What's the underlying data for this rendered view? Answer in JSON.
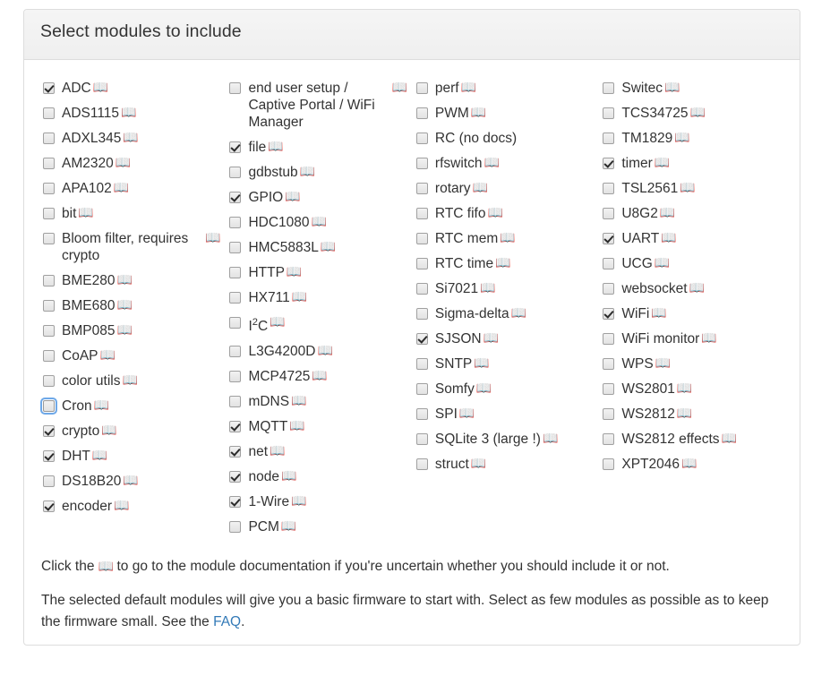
{
  "panel": {
    "title": "Select modules to include"
  },
  "icons": {
    "doc_glyph": "📖",
    "doc_color": "#4a86c8",
    "doc_color_dark": "#444444"
  },
  "columns": [
    {
      "name": "column-1",
      "modules": [
        {
          "label": "ADC",
          "checked": true,
          "doc": true,
          "focused": false
        },
        {
          "label": "ADS1115",
          "checked": false,
          "doc": true,
          "focused": false
        },
        {
          "label": "ADXL345",
          "checked": false,
          "doc": true,
          "focused": false
        },
        {
          "label": "AM2320",
          "checked": false,
          "doc": true,
          "focused": false
        },
        {
          "label": "APA102",
          "checked": false,
          "doc": true,
          "focused": false
        },
        {
          "label": "bit",
          "checked": false,
          "doc": true,
          "focused": false
        },
        {
          "label": "Bloom filter, requires crypto",
          "checked": false,
          "doc": true,
          "focused": false
        },
        {
          "label": "BME280",
          "checked": false,
          "doc": true,
          "focused": false
        },
        {
          "label": "BME680",
          "checked": false,
          "doc": true,
          "focused": false
        },
        {
          "label": "BMP085",
          "checked": false,
          "doc": true,
          "focused": false
        },
        {
          "label": "CoAP",
          "checked": false,
          "doc": true,
          "focused": false
        },
        {
          "label": "color utils",
          "checked": false,
          "doc": true,
          "focused": false
        },
        {
          "label": "Cron",
          "checked": false,
          "doc": true,
          "focused": true
        },
        {
          "label": "crypto",
          "checked": true,
          "doc": true,
          "focused": false
        },
        {
          "label": "DHT",
          "checked": true,
          "doc": true,
          "focused": false
        },
        {
          "label": "DS18B20",
          "checked": false,
          "doc": true,
          "focused": false
        },
        {
          "label": "encoder",
          "checked": true,
          "doc": true,
          "focused": false
        }
      ]
    },
    {
      "name": "column-2",
      "modules": [
        {
          "label": "end user setup / Captive Portal / WiFi Manager",
          "checked": false,
          "doc": true,
          "focused": false
        },
        {
          "label": "file",
          "checked": true,
          "doc": true,
          "focused": false
        },
        {
          "label": "gdbstub",
          "checked": false,
          "doc": true,
          "focused": false
        },
        {
          "label": "GPIO",
          "checked": true,
          "doc": true,
          "focused": false
        },
        {
          "label": "HDC1080",
          "checked": false,
          "doc": true,
          "focused": false
        },
        {
          "label": "HMC5883L",
          "checked": false,
          "doc": true,
          "focused": false
        },
        {
          "label": "HTTP",
          "checked": false,
          "doc": true,
          "focused": false
        },
        {
          "label": "HX711",
          "checked": false,
          "doc": true,
          "focused": false
        },
        {
          "label": "I²C",
          "checked": false,
          "doc": true,
          "focused": false
        },
        {
          "label": "L3G4200D",
          "checked": false,
          "doc": true,
          "focused": false
        },
        {
          "label": "MCP4725",
          "checked": false,
          "doc": true,
          "focused": false
        },
        {
          "label": "mDNS",
          "checked": false,
          "doc": true,
          "focused": false
        },
        {
          "label": "MQTT",
          "checked": true,
          "doc": true,
          "focused": false
        },
        {
          "label": "net",
          "checked": true,
          "doc": true,
          "focused": false
        },
        {
          "label": "node",
          "checked": true,
          "doc": true,
          "focused": false
        },
        {
          "label": "1-Wire",
          "checked": true,
          "doc": true,
          "focused": false
        },
        {
          "label": "PCM",
          "checked": false,
          "doc": true,
          "focused": false
        }
      ]
    },
    {
      "name": "column-3",
      "modules": [
        {
          "label": "perf",
          "checked": false,
          "doc": true,
          "focused": false
        },
        {
          "label": "PWM",
          "checked": false,
          "doc": true,
          "focused": false
        },
        {
          "label": "RC (no docs)",
          "checked": false,
          "doc": false,
          "focused": false
        },
        {
          "label": "rfswitch",
          "checked": false,
          "doc": true,
          "focused": false
        },
        {
          "label": "rotary",
          "checked": false,
          "doc": true,
          "focused": false
        },
        {
          "label": "RTC fifo",
          "checked": false,
          "doc": true,
          "focused": false
        },
        {
          "label": "RTC mem",
          "checked": false,
          "doc": true,
          "focused": false
        },
        {
          "label": "RTC time",
          "checked": false,
          "doc": true,
          "focused": false
        },
        {
          "label": "Si7021",
          "checked": false,
          "doc": true,
          "focused": false
        },
        {
          "label": "Sigma-delta",
          "checked": false,
          "doc": true,
          "focused": false
        },
        {
          "label": "SJSON",
          "checked": true,
          "doc": true,
          "focused": false
        },
        {
          "label": "SNTP",
          "checked": false,
          "doc": true,
          "focused": false
        },
        {
          "label": "Somfy",
          "checked": false,
          "doc": true,
          "focused": false
        },
        {
          "label": "SPI",
          "checked": false,
          "doc": true,
          "focused": false
        },
        {
          "label": "SQLite 3 (large !)",
          "checked": false,
          "doc": true,
          "focused": false
        },
        {
          "label": "struct",
          "checked": false,
          "doc": true,
          "focused": false
        }
      ]
    },
    {
      "name": "column-4",
      "modules": [
        {
          "label": "Switec",
          "checked": false,
          "doc": true,
          "focused": false
        },
        {
          "label": "TCS34725",
          "checked": false,
          "doc": true,
          "focused": false
        },
        {
          "label": "TM1829",
          "checked": false,
          "doc": true,
          "focused": false
        },
        {
          "label": "timer",
          "checked": true,
          "doc": true,
          "focused": false
        },
        {
          "label": "TSL2561",
          "checked": false,
          "doc": true,
          "focused": false
        },
        {
          "label": "U8G2",
          "checked": false,
          "doc": true,
          "focused": false
        },
        {
          "label": "UART",
          "checked": true,
          "doc": true,
          "focused": false
        },
        {
          "label": "UCG",
          "checked": false,
          "doc": true,
          "focused": false
        },
        {
          "label": "websocket",
          "checked": false,
          "doc": true,
          "focused": false
        },
        {
          "label": "WiFi",
          "checked": true,
          "doc": true,
          "focused": false
        },
        {
          "label": "WiFi monitor",
          "checked": false,
          "doc": true,
          "focused": false
        },
        {
          "label": "WPS",
          "checked": false,
          "doc": true,
          "focused": false
        },
        {
          "label": "WS2801",
          "checked": false,
          "doc": true,
          "focused": false
        },
        {
          "label": "WS2812",
          "checked": false,
          "doc": true,
          "focused": false
        },
        {
          "label": "WS2812 effects",
          "checked": false,
          "doc": true,
          "focused": false
        },
        {
          "label": "XPT2046",
          "checked": false,
          "doc": true,
          "focused": false
        }
      ]
    }
  ],
  "footer": {
    "note1_before": "Click the ",
    "note1_after": " to go to the module documentation if you're uncertain whether you should include it or not.",
    "note2_before": "The selected default modules will give you a basic firmware to start with. Select as few modules as possible as to keep the firmware small. See the ",
    "note2_link": "FAQ",
    "note2_after": "."
  }
}
